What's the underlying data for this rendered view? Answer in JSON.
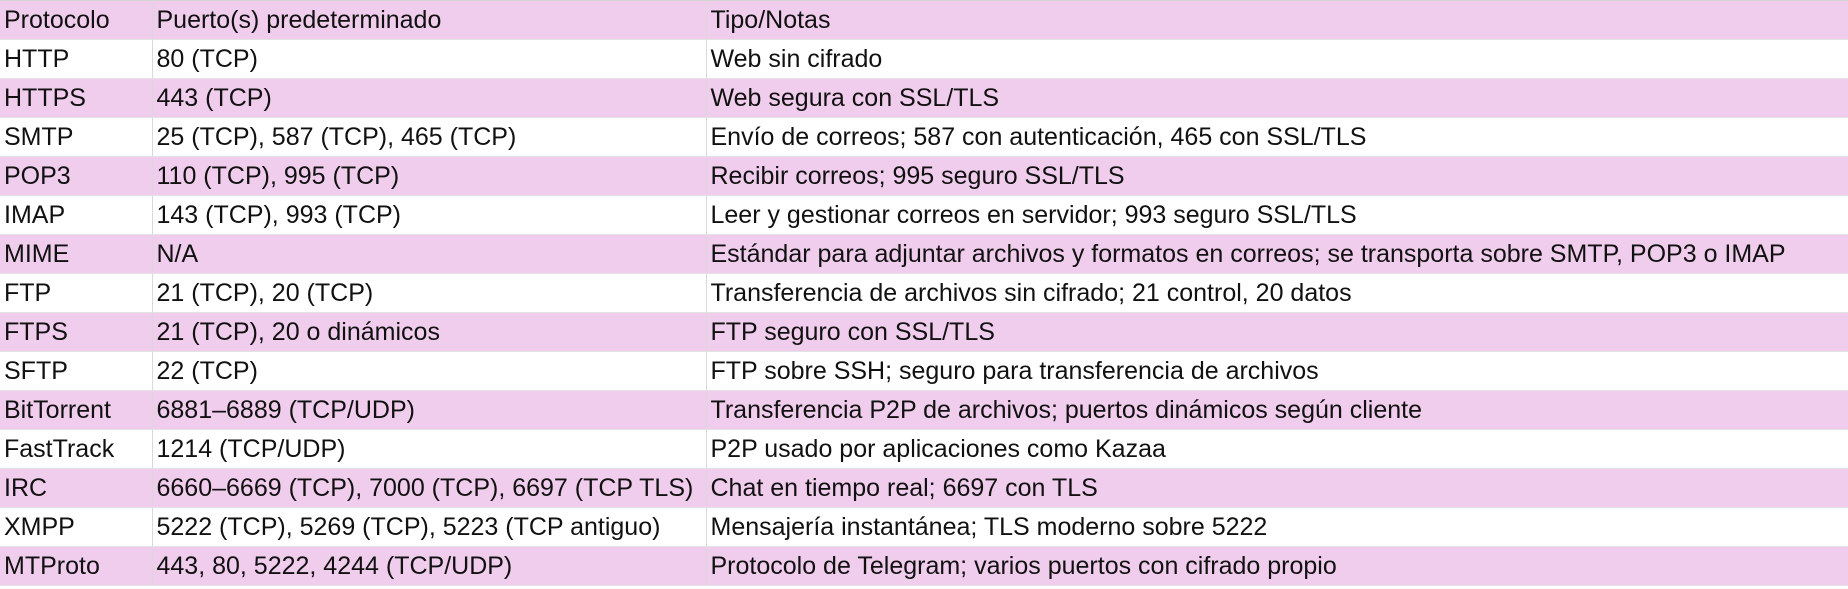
{
  "table": {
    "header": [
      "Protocolo",
      "Puerto(s) predeterminado",
      "Tipo/Notas"
    ],
    "rows": [
      [
        "HTTP",
        "80 (TCP)",
        "Web sin cifrado"
      ],
      [
        "HTTPS",
        "443 (TCP)",
        "Web segura con SSL/TLS"
      ],
      [
        "SMTP",
        "25 (TCP), 587 (TCP), 465 (TCP)",
        "Envío de correos; 587 con autenticación, 465 con SSL/TLS"
      ],
      [
        "POP3",
        "110 (TCP), 995 (TCP)",
        "Recibir correos; 995 seguro SSL/TLS"
      ],
      [
        "IMAP",
        "143 (TCP), 993 (TCP)",
        "Leer y gestionar correos en servidor; 993 seguro SSL/TLS"
      ],
      [
        "MIME",
        "N/A",
        "Estándar para adjuntar archivos y formatos en correos; se transporta sobre SMTP, POP3 o IMAP"
      ],
      [
        "FTP",
        "21 (TCP), 20 (TCP)",
        "Transferencia de archivos sin cifrado; 21 control, 20 datos"
      ],
      [
        "FTPS",
        "21 (TCP), 20 o dinámicos",
        "FTP seguro con SSL/TLS"
      ],
      [
        "SFTP",
        "22 (TCP)",
        "FTP sobre SSH; seguro para transferencia de archivos"
      ],
      [
        "BitTorrent",
        "6881–6889 (TCP/UDP)",
        "Transferencia P2P de archivos; puertos dinámicos según cliente"
      ],
      [
        "FastTrack",
        "1214 (TCP/UDP)",
        "P2P usado por aplicaciones como Kazaa"
      ],
      [
        "IRC",
        "6660–6669 (TCP), 7000 (TCP), 6697 (TCP TLS)",
        "Chat en tiempo real; 6697 con TLS"
      ],
      [
        "XMPP",
        "5222 (TCP), 5269 (TCP), 5223 (TCP antiguo)",
        "Mensajería instantánea; TLS moderno sobre 5222"
      ],
      [
        "MTProto",
        "443, 80, 5222, 4244 (TCP/UDP)",
        "Protocolo de Telegram; varios puertos con cifrado propio"
      ]
    ]
  },
  "colors": {
    "band": "#f0cdec",
    "plain": "#ffffff",
    "text": "#111111",
    "gridline": "#d9d9d9"
  }
}
